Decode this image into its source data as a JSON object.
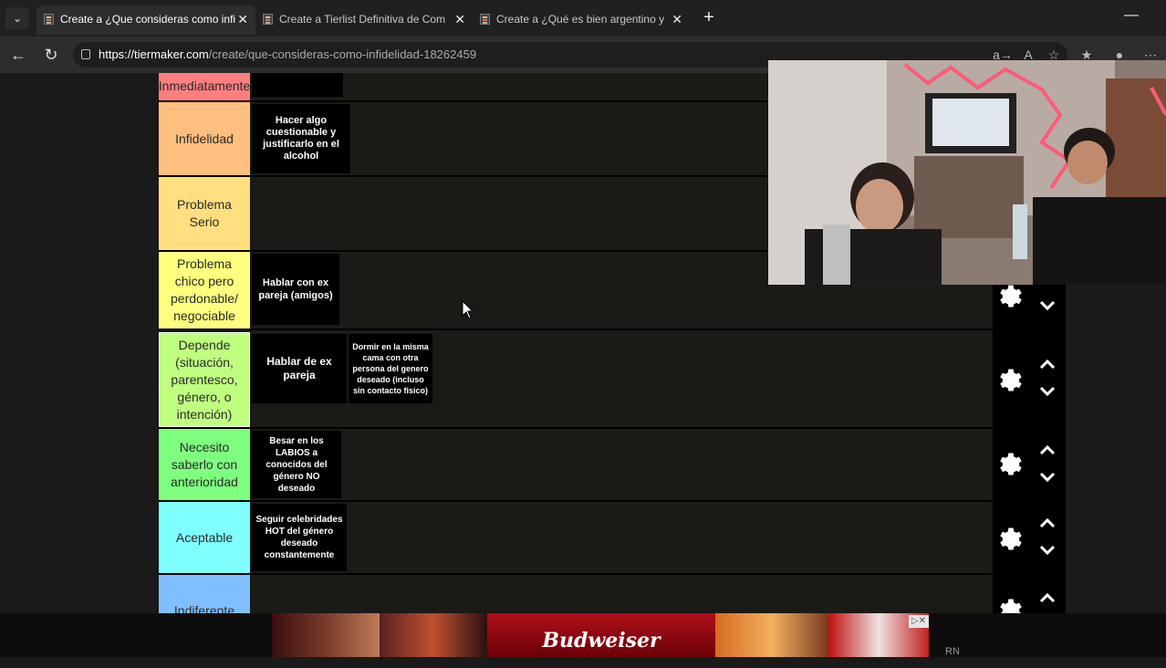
{
  "browser": {
    "tabs": [
      {
        "title": "Create a ¿Que consideras como infi",
        "active": true
      },
      {
        "title": "Create a Tierlist Definitiva de Com",
        "active": false
      },
      {
        "title": "Create a ¿Qué es bien argentino y",
        "active": false
      }
    ],
    "url_host": "https://tiermaker.com",
    "url_path": "/create/que-consideras-como-infidelidad-18262459"
  },
  "tiers": [
    {
      "label": "Inmediatamente",
      "color": "#ff7f7f",
      "items": []
    },
    {
      "label": "Infidelidad",
      "color": "#ffbf7f",
      "items": [
        "Hacer algo cuestionable y justificarlo en el alcohol"
      ]
    },
    {
      "label": "Problema Serio",
      "color": "#ffdf7f",
      "items": []
    },
    {
      "label": "Problema chico pero perdonable/ negociable",
      "color": "#ffff7f",
      "items": [
        "Hablar con ex pareja (amigos)"
      ]
    },
    {
      "label": "Depende (situación, parentesco, género, o intención)",
      "color": "#bfff7f",
      "items": [
        "Hablar de ex pareja",
        "Dormir en la misma cama con otra persona del genero deseado (incluso sin contacto fisico)"
      ]
    },
    {
      "label": "Necesito saberlo con anterioridad",
      "color": "#7fff7f",
      "items": [
        "Besar en los LABIOS a conocidos del género NO deseado"
      ]
    },
    {
      "label": "Aceptable",
      "color": "#7fffff",
      "items": [
        "Seguir celebridades HOT del género deseado constantemente"
      ]
    },
    {
      "label": "Indiferente",
      "color": "#7fbfff",
      "items": []
    }
  ],
  "ad": {
    "brand": "Budweiser",
    "corner_text": "RN"
  },
  "icons": {
    "settings": "gear-icon",
    "move_up": "chevron-up-icon",
    "move_down": "chevron-down-icon"
  }
}
